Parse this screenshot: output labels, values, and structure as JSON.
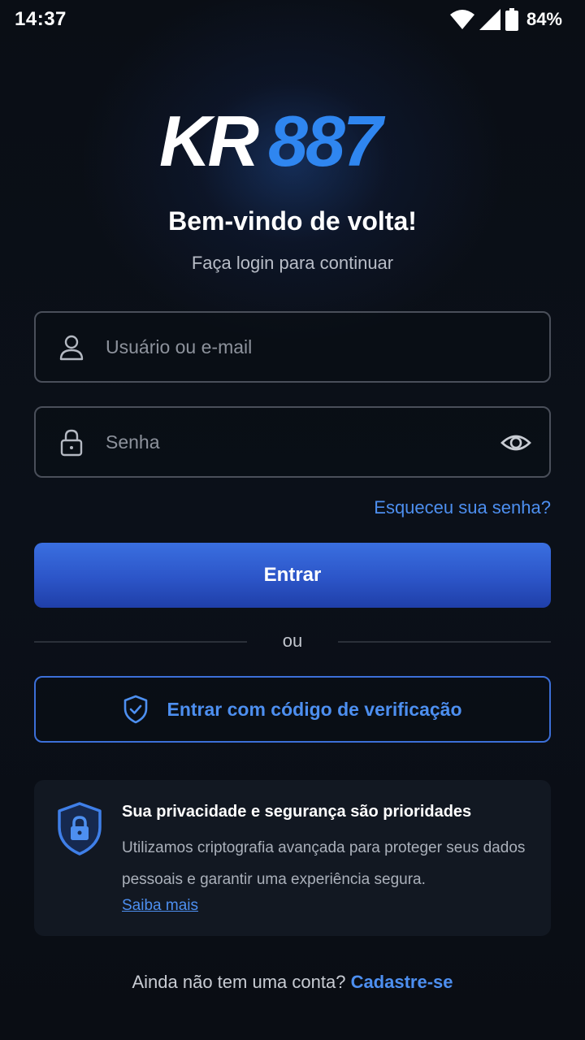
{
  "status_bar": {
    "time": "14:37",
    "battery": "84%",
    "icons": [
      "wifi-icon",
      "signal-icon",
      "battery-icon"
    ]
  },
  "logo": {
    "part1": "KR",
    "part2": "887",
    "colors": {
      "part1": "#ffffff",
      "part2": "#2f86f0"
    }
  },
  "header": {
    "title": "Bem-vindo de volta!",
    "subtitle": "Faça login para continuar"
  },
  "form": {
    "username_placeholder": "Usuário ou e-mail",
    "password_placeholder": "Senha",
    "forgot_password": "Esqueceu sua senha?",
    "submit_label": "Entrar",
    "divider": "ou",
    "verification_label": "Entrar com código de verificação"
  },
  "privacy": {
    "title": "Sua privacidade e segurança são prioridades",
    "body": "Utilizamos criptografia avançada para proteger seus dados pessoais e garantir uma experiência segura.",
    "link": "Saiba mais"
  },
  "footer": {
    "question": "Ainda não tem uma conta?",
    "signup_link": "Cadastre-se"
  },
  "colors": {
    "background": "#0b0f16",
    "accent": "#4d8ff0",
    "primary_button": "#2c55c8"
  }
}
